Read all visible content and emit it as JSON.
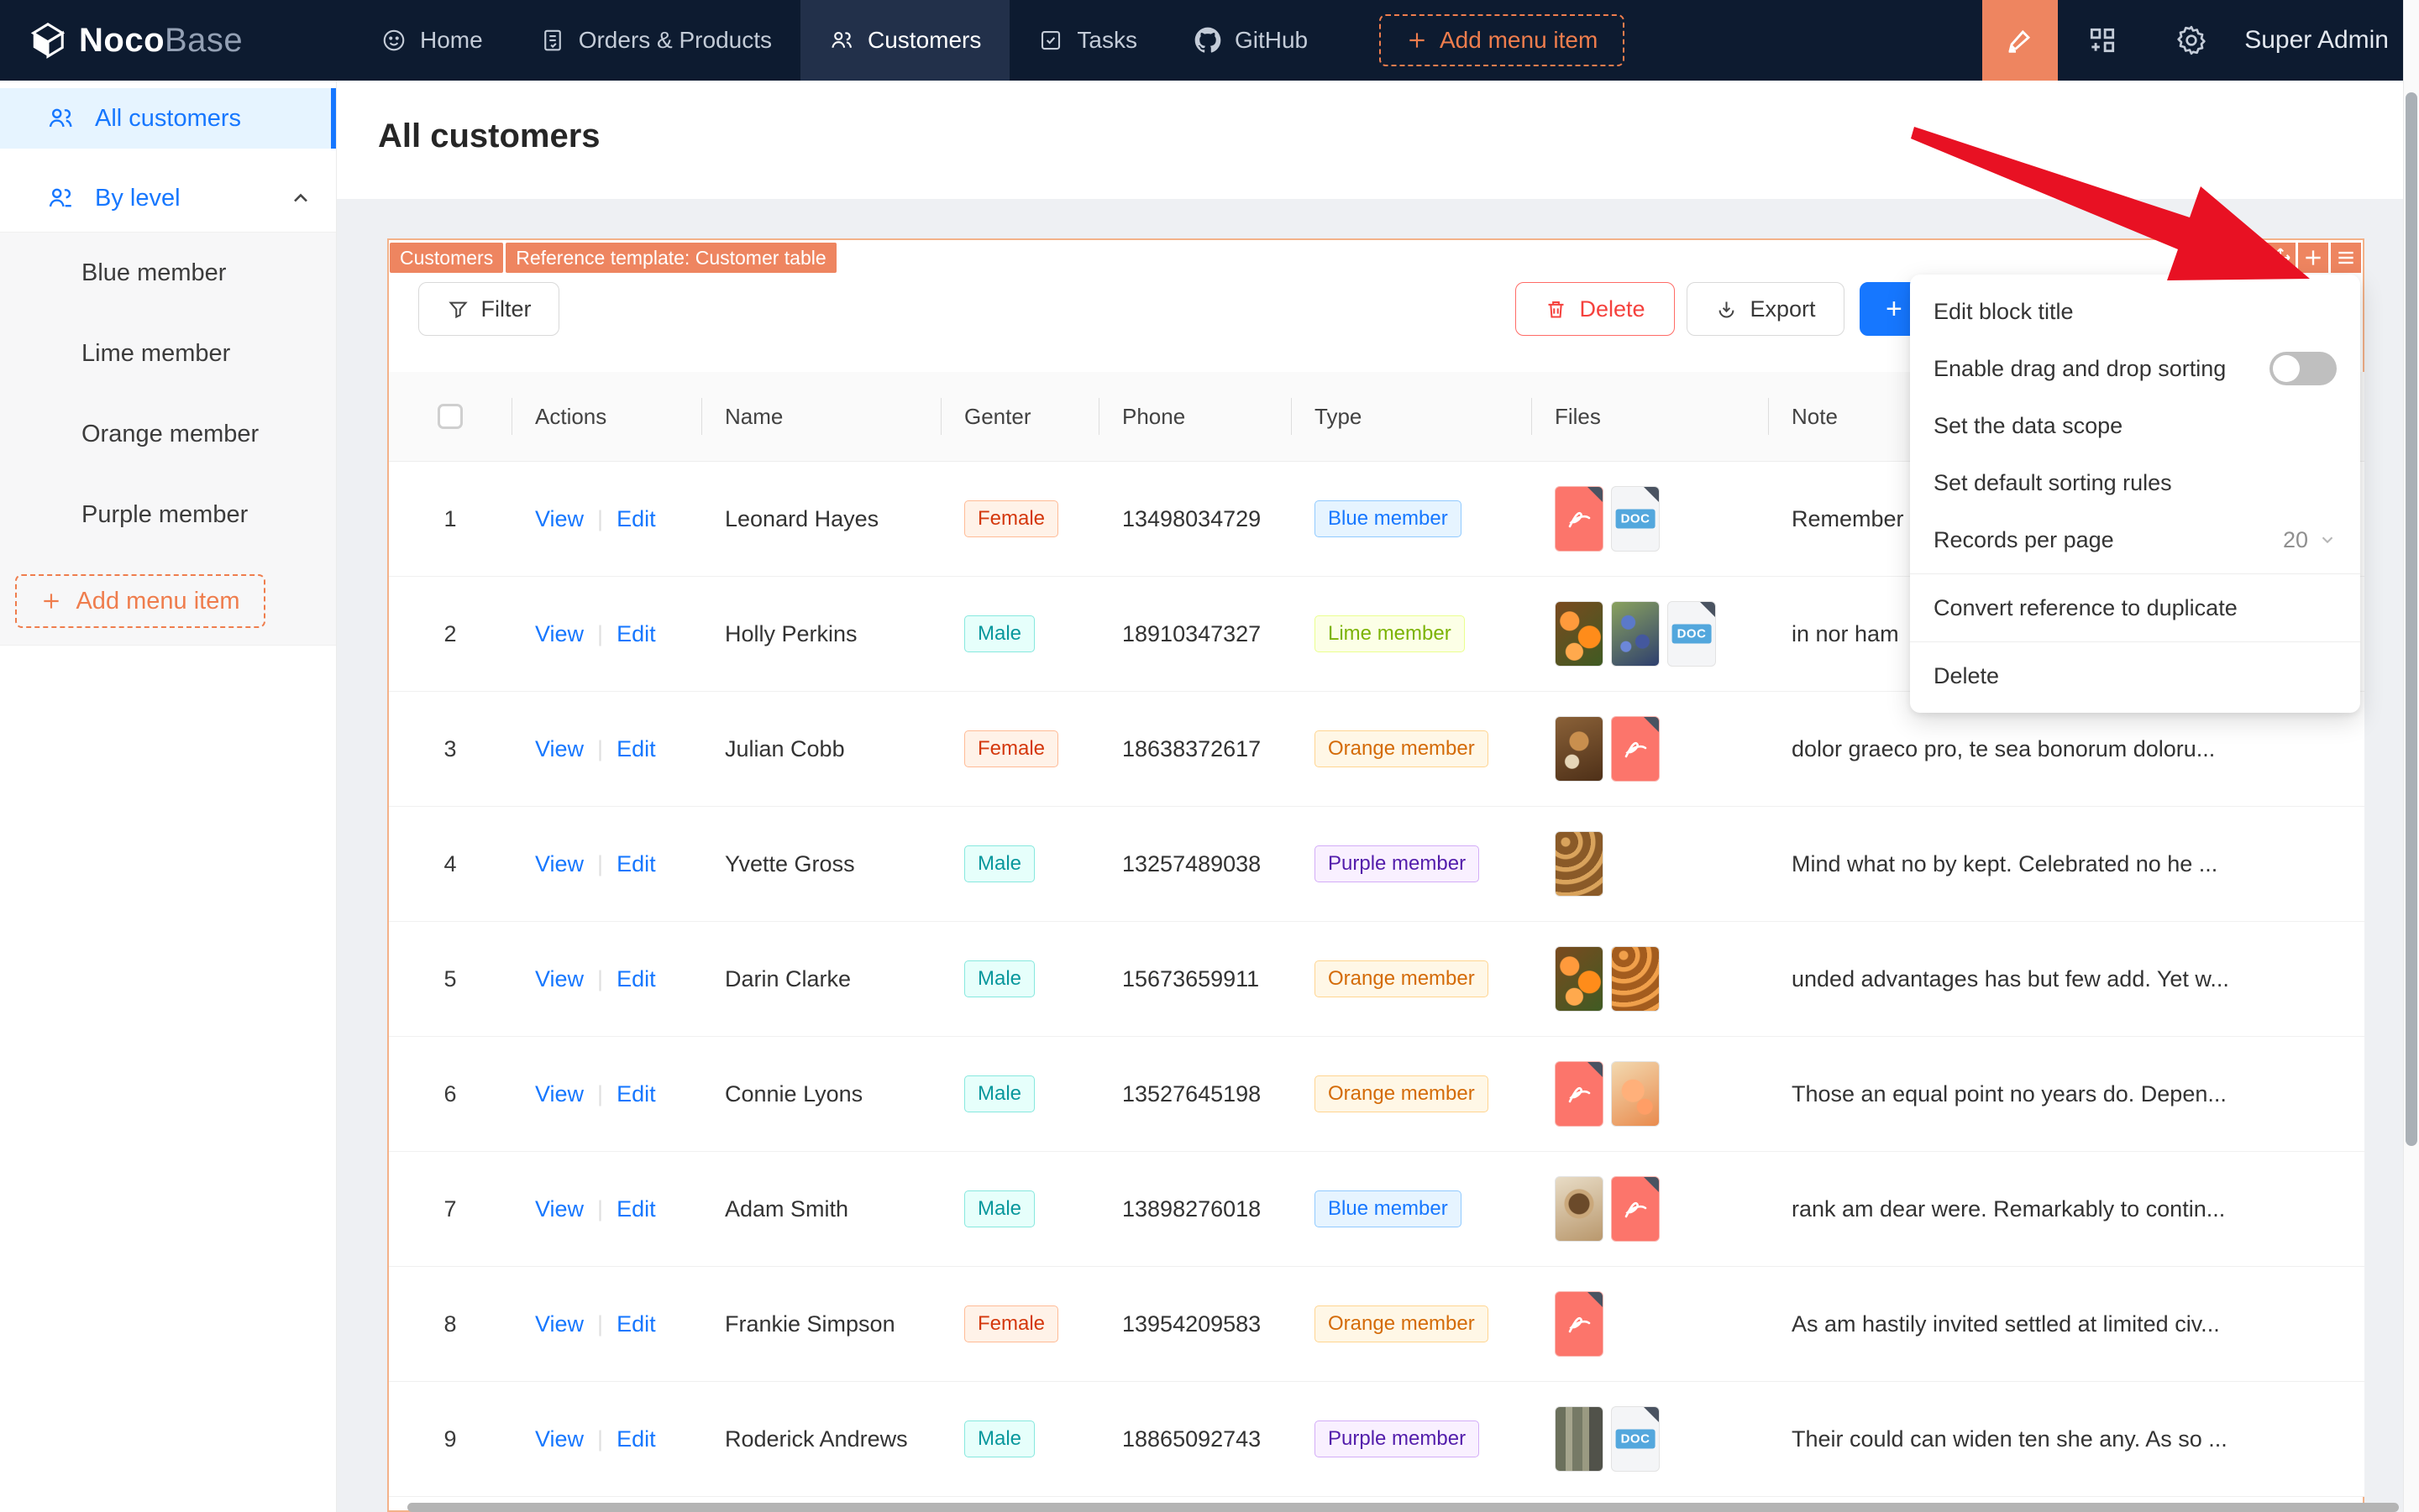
{
  "navbar": {
    "logo": {
      "noco": "Noco",
      "base": "Base"
    },
    "items": [
      {
        "label": "Home"
      },
      {
        "label": "Orders & Products"
      },
      {
        "label": "Customers",
        "active": true
      },
      {
        "label": "Tasks"
      },
      {
        "label": "GitHub"
      }
    ],
    "add_label": "Add menu item",
    "user": "Super Admin"
  },
  "sidebar": {
    "items": [
      {
        "label": "All customers",
        "active": true
      },
      {
        "label": "By level",
        "expanded": true
      }
    ],
    "sub_items": [
      "Blue member",
      "Lime member",
      "Orange member",
      "Purple member"
    ],
    "add_label": "Add menu item"
  },
  "page": {
    "title": "All customers"
  },
  "block": {
    "tags": [
      "Customers",
      "Reference template: Customer table"
    ],
    "toolbar": {
      "filter": "Filter",
      "delete": "Delete",
      "export": "Export",
      "add": "+"
    }
  },
  "table": {
    "headers": [
      "Actions",
      "Name",
      "Genter",
      "Phone",
      "Type",
      "Files",
      "Note"
    ],
    "action_labels": [
      "View",
      "Edit"
    ],
    "doc_label": "DOC",
    "rows": [
      {
        "n": "1",
        "name": "Leonard Hayes",
        "gender": "Female",
        "phone": "13498034729",
        "type": "Blue member",
        "files": [
          "pdf",
          "doc"
        ],
        "note": "Remember"
      },
      {
        "n": "2",
        "name": "Holly Perkins",
        "gender": "Male",
        "phone": "18910347327",
        "type": "Lime member",
        "files": [
          "img-oranges",
          "img-berries",
          "doc"
        ],
        "note": "in nor ham"
      },
      {
        "n": "3",
        "name": "Julian Cobb",
        "gender": "Female",
        "phone": "18638372617",
        "type": "Orange member",
        "files": [
          "img-food",
          "pdf"
        ],
        "note": "dolor graeco pro, te sea bonorum doloru..."
      },
      {
        "n": "4",
        "name": "Yvette Gross",
        "gender": "Male",
        "phone": "13257489038",
        "type": "Purple member",
        "files": [
          "img-pastry"
        ],
        "note": "Mind what no by kept. Celebrated no he ..."
      },
      {
        "n": "5",
        "name": "Darin Clarke",
        "gender": "Male",
        "phone": "15673659911",
        "type": "Orange member",
        "files": [
          "img-oranges",
          "img-pastry2"
        ],
        "note": "unded advantages has but few add. Yet w..."
      },
      {
        "n": "6",
        "name": "Connie Lyons",
        "gender": "Male",
        "phone": "13527645198",
        "type": "Orange member",
        "files": [
          "pdf",
          "img-peach"
        ],
        "note": "Those an equal point no years do. Depen..."
      },
      {
        "n": "7",
        "name": "Adam Smith",
        "gender": "Male",
        "phone": "13898276018",
        "type": "Blue member",
        "files": [
          "img-coffee",
          "pdf"
        ],
        "note": "rank am dear were. Remarkably to contin..."
      },
      {
        "n": "8",
        "name": "Frankie Simpson",
        "gender": "Female",
        "phone": "13954209583",
        "type": "Orange member",
        "files": [
          "pdf"
        ],
        "note": "As am hastily invited settled at limited civ..."
      },
      {
        "n": "9",
        "name": "Roderick Andrews",
        "gender": "Male",
        "phone": "18865092743",
        "type": "Purple member",
        "files": [
          "img-store",
          "doc"
        ],
        "note": "Their could can widen ten she any. As so ..."
      }
    ]
  },
  "menu": {
    "items": [
      "Edit block title",
      "Enable drag and drop sorting",
      "Set the data scope",
      "Set default sorting rules",
      "Records per page",
      "Convert reference to duplicate",
      "Delete"
    ],
    "records_per_page": "20",
    "drag_toggle_on": false
  },
  "colors": {
    "accent_orange": "#ee8560",
    "link_blue": "#1677ff",
    "danger_red": "#f5413d",
    "navbar_bg": "#0d1b30",
    "block_border": "#f3b289",
    "arrow_red": "#e81123",
    "tags": {
      "Female": "volcano",
      "Male": "cyan",
      "Blue member": "blue",
      "Lime member": "lime",
      "Orange member": "orange",
      "Purple member": "purple"
    }
  }
}
